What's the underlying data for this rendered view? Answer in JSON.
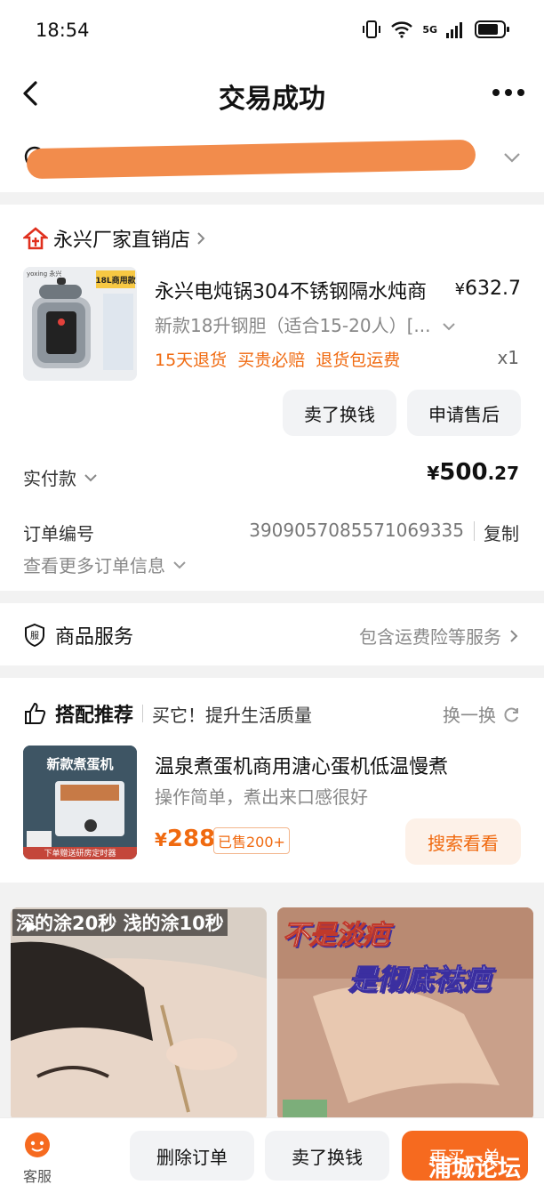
{
  "status_bar": {
    "time": "18:54",
    "network": "5G"
  },
  "nav": {
    "title": "交易成功"
  },
  "order": {
    "shop_name": "永兴厂家直销店",
    "product": {
      "title": "永兴电炖锅304不锈钢隔水炖商",
      "price_currency": "¥",
      "price": "632.7",
      "spec": "新款18升钢胆（适合15-20人）[...",
      "tags": [
        "15天退货",
        "买贵必赔",
        "退货包运费"
      ],
      "quantity": "x1",
      "image": {
        "brand": "yoxing 永兴",
        "badge": "18L商用款"
      }
    },
    "buttons": {
      "sell_for_cash": "卖了换钱",
      "after_sales": "申请售后"
    },
    "paid": {
      "label": "实付款",
      "currency": "¥",
      "int": "500",
      "dec": ".27"
    },
    "order_no_label": "订单编号",
    "order_no": "3909057085571069335",
    "copy": "复制",
    "more_info": "查看更多订单信息"
  },
  "service": {
    "label": "商品服务",
    "detail": "包含运费险等服务"
  },
  "recommend": {
    "title": "搭配推荐",
    "subtitle": "买它！提升生活质量",
    "swap": "换一换",
    "item": {
      "image_caption": "新款煮蛋机",
      "image_footer": "下单赠送研房定时器",
      "name": "温泉煮蛋机商用溏心蛋机低温慢煮",
      "desc": "操作简单，煮出来口感很好",
      "currency": "¥",
      "price": "288",
      "sold": "已售200+",
      "search": "搜索看看"
    }
  },
  "feed": [
    {
      "caption": "深的涂20秒  浅的涂10秒"
    },
    {
      "caption_line1": "不是淡疤",
      "caption_line2": "是彻底祛疤"
    }
  ],
  "bottom": {
    "customer_service": "客服",
    "delete_order": "删除订单",
    "sell_for_cash": "卖了换钱",
    "buy_again": "再买一单",
    "watermark": "浦城论坛"
  },
  "colors": {
    "accent": "#f06a10",
    "primary_button": "#f66a1f",
    "redaction": "#f28c4c"
  }
}
